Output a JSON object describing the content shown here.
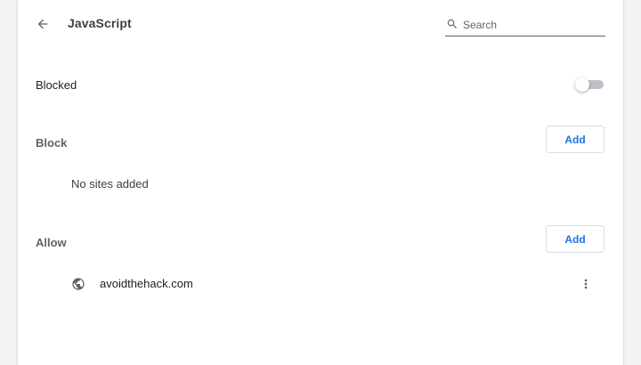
{
  "header": {
    "title": "JavaScript",
    "back_icon": "arrow-back-icon",
    "search": {
      "placeholder": "Search",
      "value": "",
      "icon": "search-icon"
    }
  },
  "blocked_setting": {
    "label": "Blocked",
    "enabled": false
  },
  "block_section": {
    "label": "Block",
    "add_label": "Add",
    "empty_text": "No sites added",
    "sites": []
  },
  "allow_section": {
    "label": "Allow",
    "add_label": "Add",
    "sites": [
      {
        "name": "avoidthehack.com",
        "icon": "globe-icon",
        "menu_icon": "more-vert-icon"
      }
    ]
  },
  "colors": {
    "accent": "#1a73e8",
    "toggle_off_track": "#bdc1c6",
    "secondary_text": "#5f6368"
  }
}
